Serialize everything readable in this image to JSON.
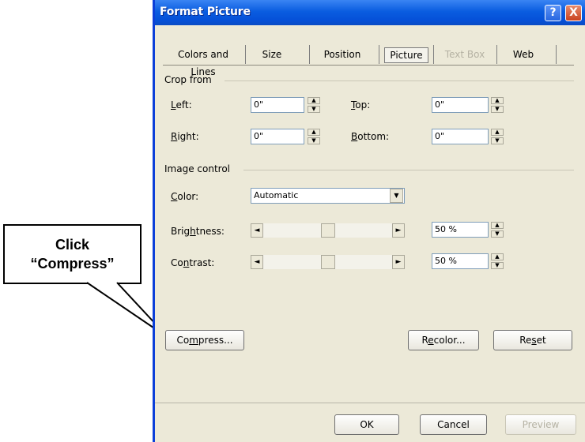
{
  "window": {
    "title": "Format Picture",
    "help_label": "?",
    "close_label": "X"
  },
  "tabs": [
    {
      "label": "Colors and Lines",
      "active": false,
      "enabled": true
    },
    {
      "label": "Size",
      "active": false,
      "enabled": true
    },
    {
      "label": "Position",
      "active": false,
      "enabled": true
    },
    {
      "label": "Picture",
      "active": true,
      "enabled": true
    },
    {
      "label": "Text Box",
      "active": false,
      "enabled": false
    },
    {
      "label": "Web",
      "active": false,
      "enabled": true
    }
  ],
  "crop": {
    "group_label": "Crop from",
    "left": {
      "pre": "",
      "mnemonic": "L",
      "post": "eft:",
      "value": "0\""
    },
    "top": {
      "pre": "",
      "mnemonic": "T",
      "post": "op:",
      "value": "0\""
    },
    "right": {
      "pre": "",
      "mnemonic": "R",
      "post": "ight:",
      "value": "0\""
    },
    "bottom": {
      "pre": "",
      "mnemonic": "B",
      "post": "ottom:",
      "value": "0\""
    }
  },
  "image_control": {
    "group_label": "Image control",
    "color": {
      "pre": "",
      "mnemonic": "C",
      "post": "olor:",
      "value": "Automatic"
    },
    "brightness": {
      "pre": "Brig",
      "mnemonic": "h",
      "post": "tness:",
      "value": "50 %",
      "level": 0.5
    },
    "contrast": {
      "pre": "Co",
      "mnemonic": "n",
      "post": "trast:",
      "value": "50 %",
      "level": 0.5
    }
  },
  "actions": {
    "compress": {
      "pre": "Co",
      "mnemonic": "m",
      "post": "press..."
    },
    "recolor": {
      "pre": "R",
      "mnemonic": "e",
      "post": "color..."
    },
    "reset": {
      "pre": "Re",
      "mnemonic": "s",
      "post": "et"
    }
  },
  "footer": {
    "ok": "OK",
    "cancel": "Cancel",
    "preview": "Preview"
  },
  "callout": {
    "line1": "Click",
    "line2": "“Compress”"
  },
  "icons": {
    "spin_up": "▲",
    "spin_down": "▼",
    "dropdown": "▼",
    "left_arrow": "◄",
    "right_arrow": "►"
  },
  "colors": {
    "titlebar": "#0a5de0",
    "dialog_face": "#ece9d8",
    "close_button": "#c94320"
  }
}
